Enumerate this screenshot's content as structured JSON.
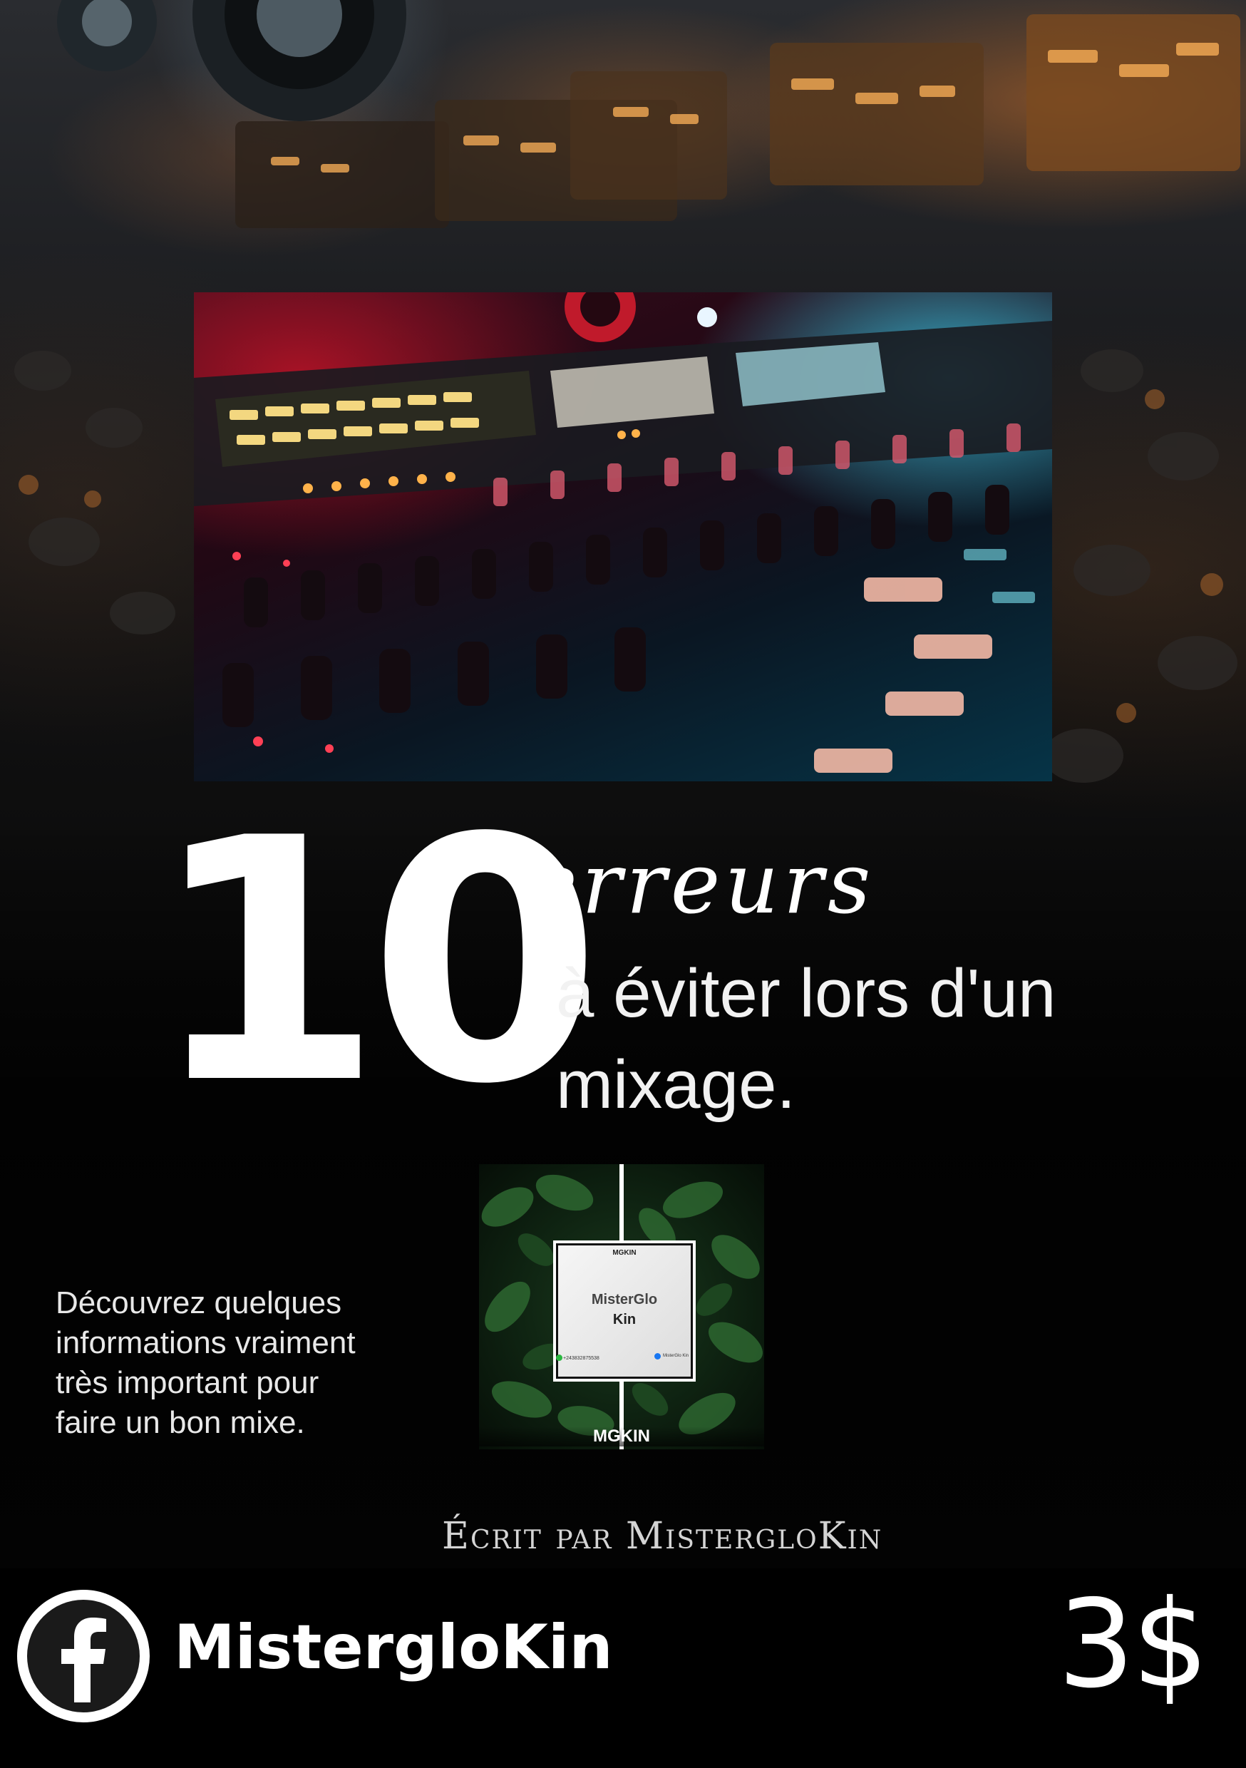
{
  "cover": {
    "number": "10",
    "script_word": "erreurs",
    "subtitle": "à éviter lors d'un mixage.",
    "description": "Découvrez quelques\ninformations vraiment\n très important pour\nfaire un bon mixe.",
    "author": "Écrit par MistergloKin"
  },
  "logo": {
    "top_tag": "MGKIN",
    "name_a": "MisterGlo",
    "name_b": "Kin",
    "phone": "+243832875538",
    "fb_text": "MisterGlo Kin",
    "bottom_label": "MGKIN"
  },
  "footer": {
    "social_icon": "facebook-icon",
    "brand_name": "MistergloKin",
    "price": "3$"
  },
  "colors": {
    "background": "#050505",
    "text": "#ffffff",
    "hero_red": "#c0142c",
    "hero_cyan": "#3cc8e6"
  }
}
